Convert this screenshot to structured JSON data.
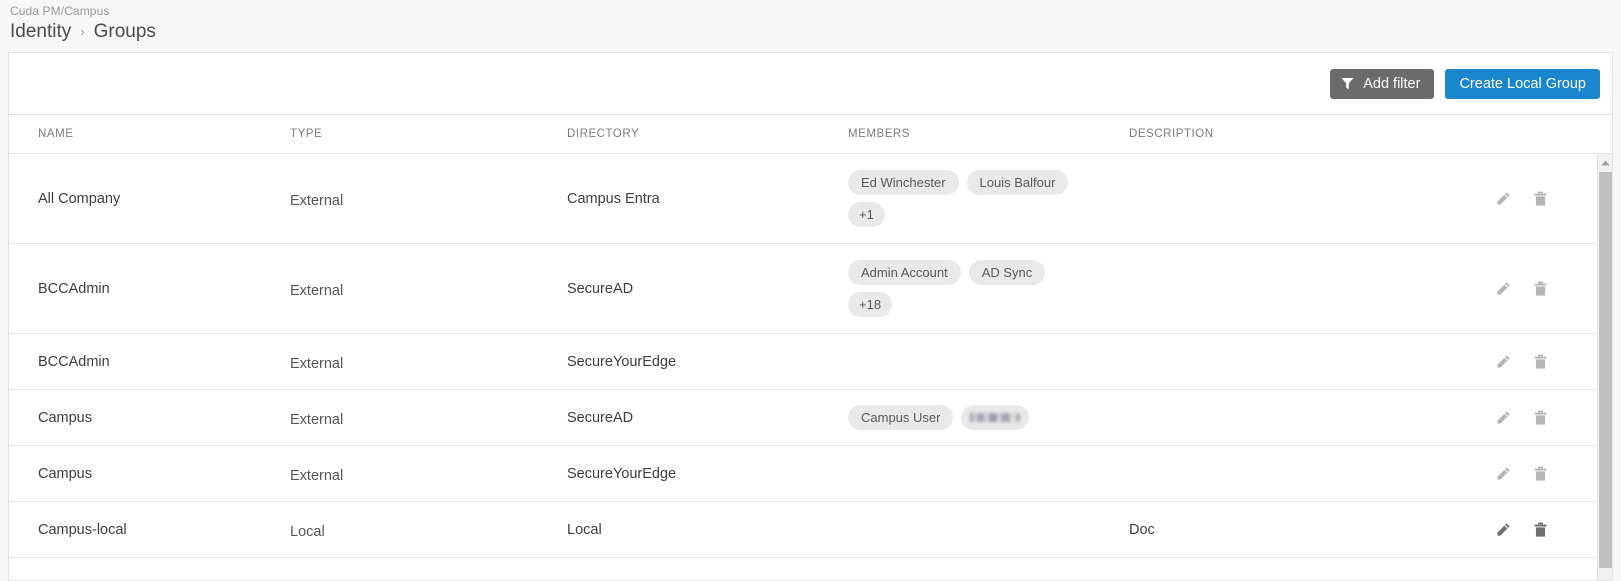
{
  "header": {
    "context": "Cuda PM/Campus",
    "parent": "Identity",
    "separator": "›",
    "current": "Groups"
  },
  "toolbar": {
    "add_filter_label": "Add filter",
    "add_filter_icon": "funnel-icon",
    "create_label": "Create Local Group",
    "filter_button_color": "#6b6b6b",
    "primary_button_color": "#1a86cd"
  },
  "table": {
    "columns": [
      "NAME",
      "TYPE",
      "DIRECTORY",
      "MEMBERS",
      "DESCRIPTION"
    ],
    "row_actions": [
      "edit-icon",
      "delete-icon"
    ],
    "rows": [
      {
        "name": "All Company",
        "type": "External",
        "directory": "Campus Entra",
        "members": [
          "Ed Winchester",
          "Louis Balfour"
        ],
        "overflow": "+1",
        "description": ""
      },
      {
        "name": "BCCAdmin",
        "type": "External",
        "directory": "SecureAD",
        "members": [
          "Admin Account",
          "AD Sync"
        ],
        "overflow": "+18",
        "description": ""
      },
      {
        "name": "BCCAdmin",
        "type": "External",
        "directory": "SecureYourEdge",
        "members": [],
        "overflow": "",
        "description": ""
      },
      {
        "name": "Campus",
        "type": "External",
        "directory": "SecureAD",
        "members": [
          "Campus User"
        ],
        "redacted_member": "",
        "overflow": "",
        "description": ""
      },
      {
        "name": "Campus",
        "type": "External",
        "directory": "SecureYourEdge",
        "members": [],
        "overflow": "",
        "description": ""
      },
      {
        "name": "Campus-local",
        "type": "Local",
        "directory": "Local",
        "members": [],
        "overflow": "",
        "description": "Doc"
      }
    ]
  },
  "scrollbar": {
    "up_arrow_icon": "caret-up-icon",
    "thumb_color": "#c0c0c0"
  }
}
